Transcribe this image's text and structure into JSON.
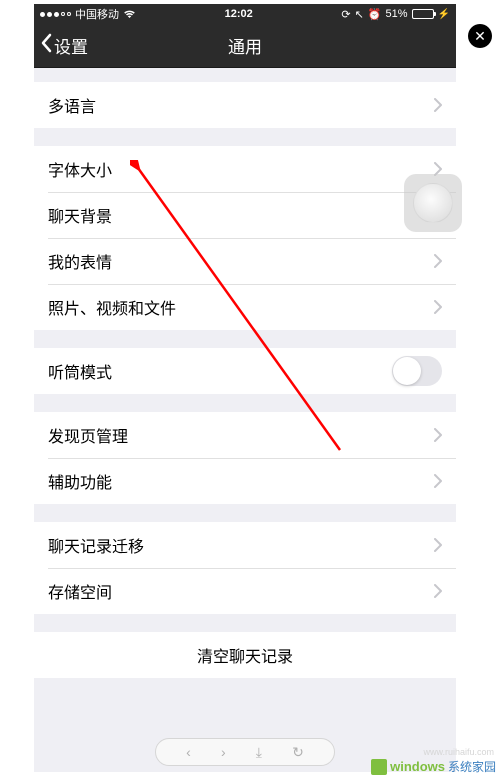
{
  "status": {
    "carrier": "中国移动",
    "time": "12:02",
    "battery_pct": "51%"
  },
  "nav": {
    "back_label": "设置",
    "title": "通用"
  },
  "groups": [
    {
      "cells": [
        {
          "label": "多语言",
          "type": "disclosure"
        }
      ]
    },
    {
      "cells": [
        {
          "label": "字体大小",
          "type": "disclosure"
        },
        {
          "label": "聊天背景",
          "type": "disclosure"
        },
        {
          "label": "我的表情",
          "type": "disclosure"
        },
        {
          "label": "照片、视频和文件",
          "type": "disclosure"
        }
      ]
    },
    {
      "cells": [
        {
          "label": "听筒模式",
          "type": "toggle",
          "on": false
        }
      ]
    },
    {
      "cells": [
        {
          "label": "发现页管理",
          "type": "disclosure"
        },
        {
          "label": "辅助功能",
          "type": "disclosure"
        }
      ]
    },
    {
      "cells": [
        {
          "label": "聊天记录迁移",
          "type": "disclosure"
        },
        {
          "label": "存储空间",
          "type": "disclosure"
        }
      ]
    },
    {
      "cells": [
        {
          "label": "清空聊天记录",
          "type": "center"
        }
      ]
    }
  ],
  "watermark": {
    "brand": "windows",
    "rest": "系统家园",
    "url": "www.ruihaifu.com"
  }
}
